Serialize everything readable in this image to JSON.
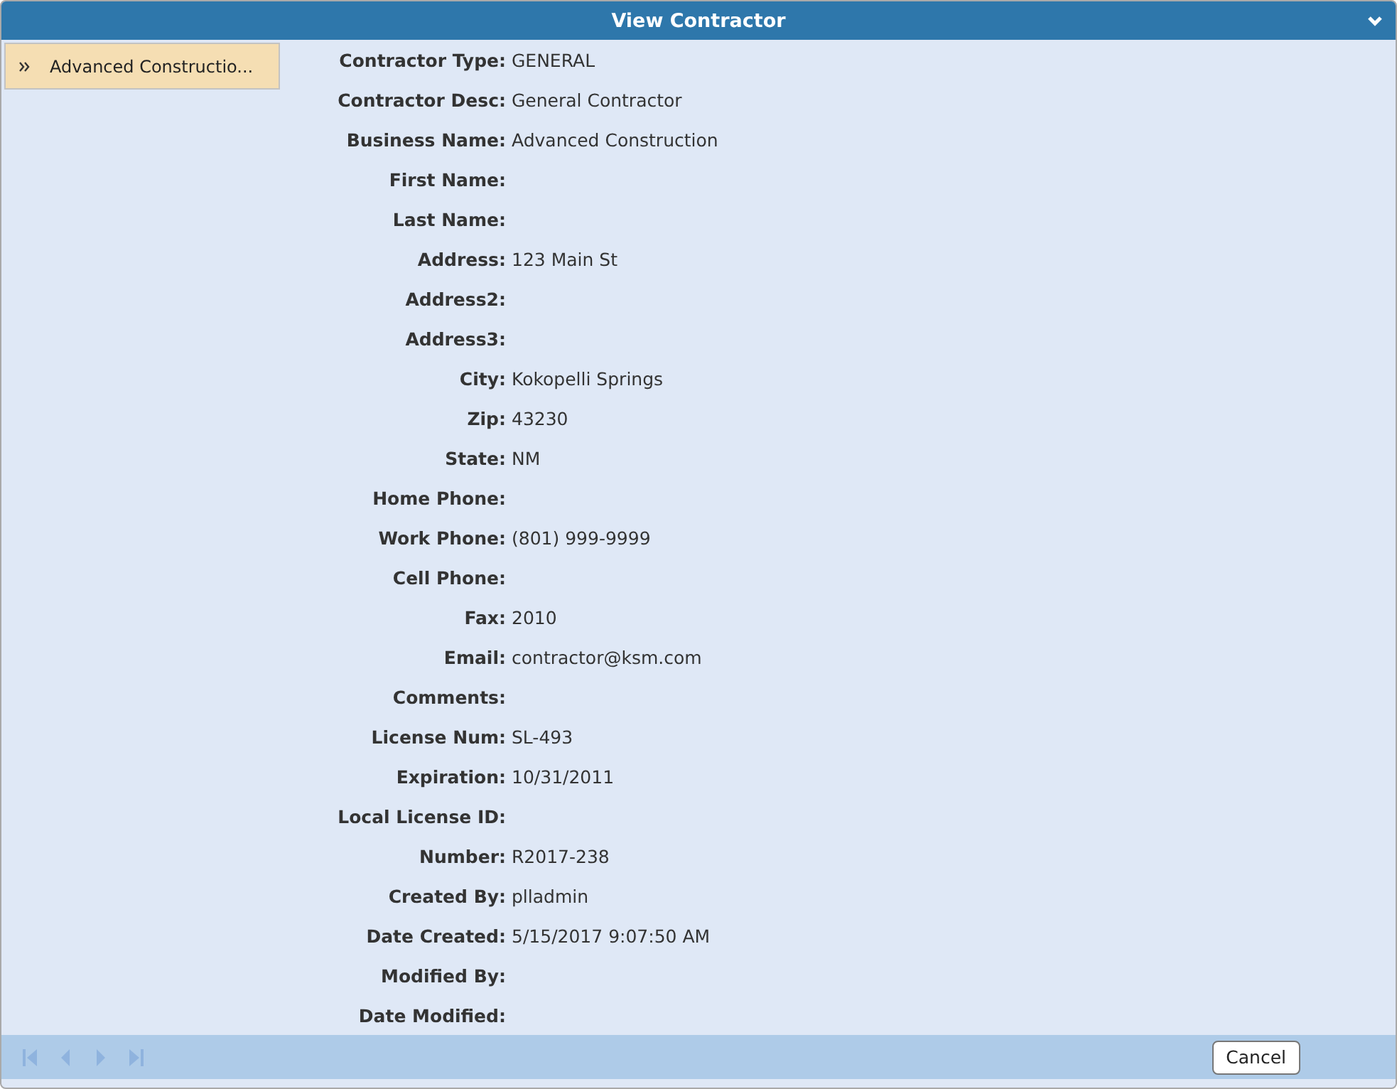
{
  "window": {
    "title": "View Contractor"
  },
  "sidebar": {
    "items": [
      {
        "label": "Advanced Constructio...",
        "selected": true
      }
    ]
  },
  "fields": [
    {
      "label": "Contractor Type:",
      "value": "GENERAL"
    },
    {
      "label": "Contractor Desc:",
      "value": "General Contractor"
    },
    {
      "label": "Business Name:",
      "value": "Advanced Construction"
    },
    {
      "label": "First Name:"
    },
    {
      "label": "Last Name:"
    },
    {
      "label": "Address:",
      "value": "123 Main St"
    },
    {
      "label": "Address2:"
    },
    {
      "label": "Address3:"
    },
    {
      "label": "City:",
      "value": "Kokopelli Springs"
    },
    {
      "label": "Zip:",
      "value": "43230"
    },
    {
      "label": "State:",
      "value": "NM"
    },
    {
      "label": "Home Phone:"
    },
    {
      "label": "Work Phone:",
      "value": "(801) 999-9999"
    },
    {
      "label": "Cell Phone:"
    },
    {
      "label": "Fax:",
      "value": "2010"
    },
    {
      "label": "Email:",
      "value": "contractor@ksm.com"
    },
    {
      "label": "Comments:"
    },
    {
      "label": "License Num:",
      "value": "SL-493"
    },
    {
      "label": "Expiration:",
      "value": "10/31/2011"
    },
    {
      "label": "Local License ID:"
    },
    {
      "label": "Number:",
      "value": "R2017-238"
    },
    {
      "label": "Created By:",
      "value": "plladmin"
    },
    {
      "label": "Date Created:",
      "value": "5/15/2017 9:07:50 AM"
    },
    {
      "label": "Modified By:"
    },
    {
      "label": "Date Modified:"
    }
  ],
  "footer": {
    "nav": [
      {
        "kind": "first",
        "disabled": true
      },
      {
        "kind": "prev",
        "disabled": true
      },
      {
        "kind": "next",
        "disabled": true
      },
      {
        "kind": "last",
        "disabled": true
      }
    ],
    "buttons": [
      "Cancel"
    ]
  }
}
